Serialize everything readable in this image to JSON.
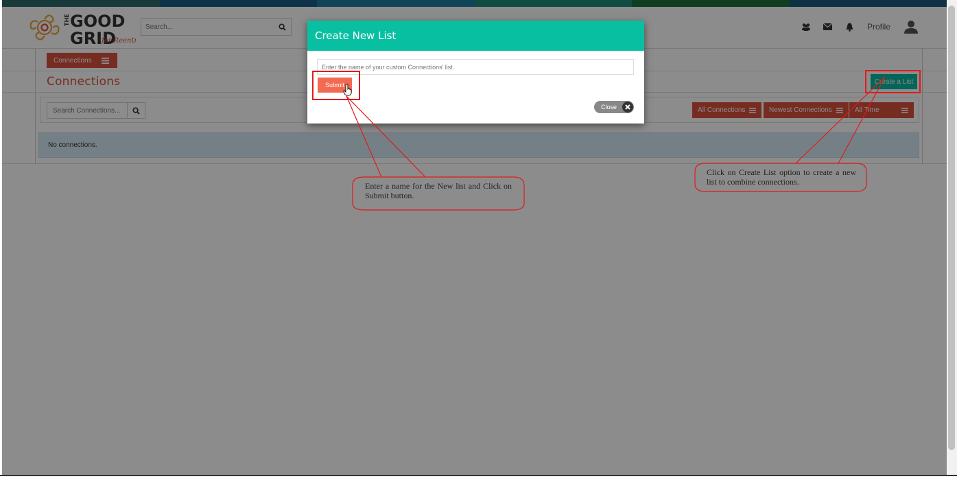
{
  "colors": {
    "topbar": [
      "#2d6a6a",
      "#1b5e86",
      "#1f7aa2",
      "#1e8a78",
      "#1b6f3a",
      "#1b5a7a"
    ],
    "brand_red": "#d9503f",
    "brand_teal": "#09bfa2",
    "callout_red": "#e01b1b"
  },
  "header": {
    "logo_line1": "THE GOOD",
    "logo_line2": "GRID",
    "logo_tagline": "for Reentry",
    "search_placeholder": "Search...",
    "search_icon": "magnifier-icon",
    "icons": [
      "users-icon",
      "envelope-icon",
      "bell-icon"
    ],
    "profile_label": "Profile",
    "avatar_icon": "user-avatar-icon"
  },
  "connections": {
    "dropdown_label": "Connections",
    "title": "Connections",
    "create_list_label": "Create a List",
    "search_placeholder": "Search Connections...",
    "filters": {
      "all": "All Connections",
      "newest": "Newest Connections",
      "time": "All Time"
    },
    "empty_message": "No connections."
  },
  "modal": {
    "title": "Create New List",
    "input_placeholder": "Enter the name of your custom Connections' list.",
    "submit_label": "Submit",
    "close_label": "Close"
  },
  "callouts": {
    "submit_note": "Enter a name for the New list and Click on Submit button.",
    "create_note": "Click on Create List option to create a new list to combine connections."
  }
}
